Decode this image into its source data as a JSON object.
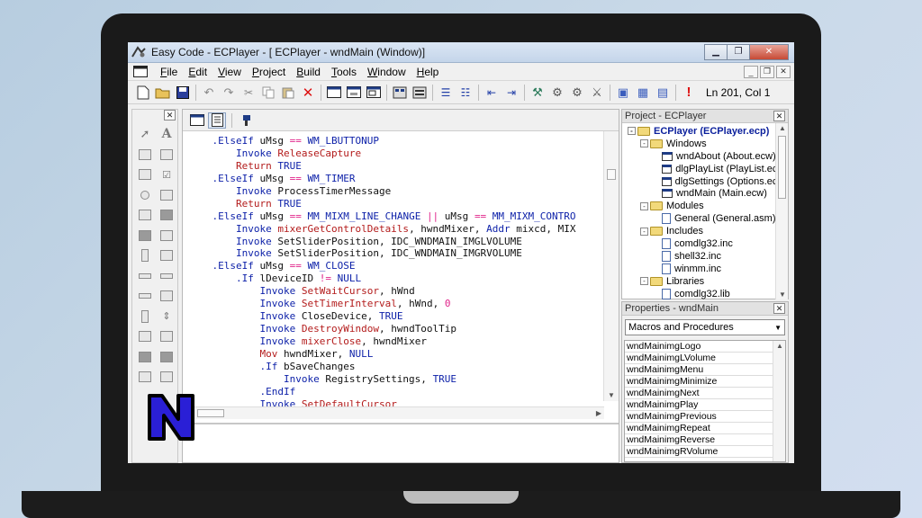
{
  "window": {
    "title": "Easy Code - ECPlayer - [ ECPlayer - wndMain (Window)]",
    "caption_buttons": [
      "minimize-icon",
      "maximize-icon",
      "close-icon"
    ]
  },
  "menu": {
    "items": [
      {
        "label": "File",
        "accel": "F"
      },
      {
        "label": "Edit",
        "accel": "E"
      },
      {
        "label": "View",
        "accel": "V"
      },
      {
        "label": "Project",
        "accel": "P"
      },
      {
        "label": "Build",
        "accel": "B"
      },
      {
        "label": "Tools",
        "accel": "T"
      },
      {
        "label": "Window",
        "accel": "W"
      },
      {
        "label": "Help",
        "accel": "H"
      }
    ]
  },
  "toolbar": {
    "line_col": "Ln 201, Col 1"
  },
  "editor": {
    "lines": [
      [
        {
          "t": "    ",
          "c": "tx"
        },
        {
          "t": ".ElseIf",
          "c": "kw"
        },
        {
          "t": " uMsg ",
          "c": "tx"
        },
        {
          "t": "==",
          "c": "op"
        },
        {
          "t": " WM_LBUTTONUP",
          "c": "kw"
        }
      ],
      [
        {
          "t": "        ",
          "c": "tx"
        },
        {
          "t": "Invoke",
          "c": "kw"
        },
        {
          "t": " ReleaseCapture",
          "c": "fn"
        }
      ],
      [
        {
          "t": "        ",
          "c": "tx"
        },
        {
          "t": "Return",
          "c": "fn"
        },
        {
          "t": " TRUE",
          "c": "kw"
        }
      ],
      [
        {
          "t": "    ",
          "c": "tx"
        },
        {
          "t": ".ElseIf",
          "c": "kw"
        },
        {
          "t": " uMsg ",
          "c": "tx"
        },
        {
          "t": "==",
          "c": "op"
        },
        {
          "t": " WM_TIMER",
          "c": "kw"
        }
      ],
      [
        {
          "t": "        ",
          "c": "tx"
        },
        {
          "t": "Invoke",
          "c": "kw"
        },
        {
          "t": " ProcessTimerMessage",
          "c": "tx"
        }
      ],
      [
        {
          "t": "        ",
          "c": "tx"
        },
        {
          "t": "Return",
          "c": "fn"
        },
        {
          "t": " TRUE",
          "c": "kw"
        }
      ],
      [
        {
          "t": "    ",
          "c": "tx"
        },
        {
          "t": ".ElseIf",
          "c": "kw"
        },
        {
          "t": " uMsg ",
          "c": "tx"
        },
        {
          "t": "==",
          "c": "op"
        },
        {
          "t": " MM_MIXM_LINE_CHANGE ",
          "c": "kw"
        },
        {
          "t": "||",
          "c": "op"
        },
        {
          "t": " uMsg ",
          "c": "tx"
        },
        {
          "t": "==",
          "c": "op"
        },
        {
          "t": " MM_MIXM_CONTRO",
          "c": "kw"
        }
      ],
      [
        {
          "t": "        ",
          "c": "tx"
        },
        {
          "t": "Invoke",
          "c": "kw"
        },
        {
          "t": " mixerGetControlDetails",
          "c": "fn"
        },
        {
          "t": ", hwndMixer, ",
          "c": "tx"
        },
        {
          "t": "Addr",
          "c": "kw"
        },
        {
          "t": " mixcd, MIX",
          "c": "tx"
        }
      ],
      [
        {
          "t": "        ",
          "c": "tx"
        },
        {
          "t": "Invoke",
          "c": "kw"
        },
        {
          "t": " SetSliderPosition, IDC_WNDMAIN_IMGLVOLUME",
          "c": "tx"
        }
      ],
      [
        {
          "t": "        ",
          "c": "tx"
        },
        {
          "t": "Invoke",
          "c": "kw"
        },
        {
          "t": " SetSliderPosition, IDC_WNDMAIN_IMGRVOLUME",
          "c": "tx"
        }
      ],
      [
        {
          "t": "    ",
          "c": "tx"
        },
        {
          "t": ".ElseIf",
          "c": "kw"
        },
        {
          "t": " uMsg ",
          "c": "tx"
        },
        {
          "t": "==",
          "c": "op"
        },
        {
          "t": " WM_CLOSE",
          "c": "kw"
        }
      ],
      [
        {
          "t": "        ",
          "c": "tx"
        },
        {
          "t": ".If",
          "c": "kw"
        },
        {
          "t": " lDeviceID ",
          "c": "tx"
        },
        {
          "t": "!=",
          "c": "op"
        },
        {
          "t": " NULL",
          "c": "kw"
        }
      ],
      [
        {
          "t": "            ",
          "c": "tx"
        },
        {
          "t": "Invoke",
          "c": "kw"
        },
        {
          "t": " SetWaitCursor",
          "c": "fn"
        },
        {
          "t": ", hWnd",
          "c": "tx"
        }
      ],
      [
        {
          "t": "            ",
          "c": "tx"
        },
        {
          "t": "Invoke",
          "c": "kw"
        },
        {
          "t": " SetTimerInterval",
          "c": "fn"
        },
        {
          "t": ", hWnd, ",
          "c": "tx"
        },
        {
          "t": "0",
          "c": "num"
        }
      ],
      [
        {
          "t": "            ",
          "c": "tx"
        },
        {
          "t": "Invoke",
          "c": "kw"
        },
        {
          "t": " CloseDevice, ",
          "c": "tx"
        },
        {
          "t": "TRUE",
          "c": "kw"
        }
      ],
      [
        {
          "t": "            ",
          "c": "tx"
        },
        {
          "t": "Invoke",
          "c": "kw"
        },
        {
          "t": " DestroyWindow",
          "c": "fn"
        },
        {
          "t": ", hwndToolTip",
          "c": "tx"
        }
      ],
      [
        {
          "t": "            ",
          "c": "tx"
        },
        {
          "t": "Invoke",
          "c": "kw"
        },
        {
          "t": " mixerClose",
          "c": "fn"
        },
        {
          "t": ", hwndMixer",
          "c": "tx"
        }
      ],
      [
        {
          "t": "            ",
          "c": "tx"
        },
        {
          "t": "Mov",
          "c": "fn"
        },
        {
          "t": " hwndMixer, ",
          "c": "tx"
        },
        {
          "t": "NULL",
          "c": "kw"
        }
      ],
      [
        {
          "t": "            ",
          "c": "tx"
        },
        {
          "t": ".If",
          "c": "kw"
        },
        {
          "t": " bSaveChanges",
          "c": "tx"
        }
      ],
      [
        {
          "t": "                ",
          "c": "tx"
        },
        {
          "t": "Invoke",
          "c": "kw"
        },
        {
          "t": " RegistrySettings, ",
          "c": "tx"
        },
        {
          "t": "TRUE",
          "c": "kw"
        }
      ],
      [
        {
          "t": "            ",
          "c": "tx"
        },
        {
          "t": ".EndIf",
          "c": "kw"
        }
      ],
      [
        {
          "t": "            ",
          "c": "tx"
        },
        {
          "t": "Invoke",
          "c": "kw"
        },
        {
          "t": " SetDefaultCursor",
          "c": "fn"
        }
      ]
    ]
  },
  "project": {
    "title": "Project - ECPlayer",
    "tree": [
      {
        "label": "ECPlayer (ECPlayer.ecp)",
        "kind": "root",
        "expanded": "-"
      },
      {
        "label": "Windows",
        "kind": "folder",
        "expanded": "-"
      },
      {
        "label": "wndAbout (About.ecw)",
        "kind": "window"
      },
      {
        "label": "dlgPlayList (PlayList.ecw)",
        "kind": "window"
      },
      {
        "label": "dlgSettings (Options.ecw)",
        "kind": "window"
      },
      {
        "label": "wndMain (Main.ecw)",
        "kind": "window"
      },
      {
        "label": "Modules",
        "kind": "folder",
        "expanded": "-"
      },
      {
        "label": "General (General.asm)",
        "kind": "file"
      },
      {
        "label": "Includes",
        "kind": "folder",
        "expanded": "-"
      },
      {
        "label": "comdlg32.inc",
        "kind": "file"
      },
      {
        "label": "shell32.inc",
        "kind": "file"
      },
      {
        "label": "winmm.inc",
        "kind": "file"
      },
      {
        "label": "Libraries",
        "kind": "folder",
        "expanded": "-"
      },
      {
        "label": "comdlg32.lib",
        "kind": "file"
      }
    ]
  },
  "properties": {
    "title": "Properties - wndMain",
    "dropdown_value": "Macros and Procedures",
    "items": [
      "wndMainimgLogo",
      "wndMainimgLVolume",
      "wndMainimgMenu",
      "wndMainimgMinimize",
      "wndMainimgNext",
      "wndMainimgPlay",
      "wndMainimgPrevious",
      "wndMainimgRepeat",
      "wndMainimgReverse",
      "wndMainimgRVolume"
    ]
  },
  "colors": {
    "keyword": "#0b1fa8",
    "function": "#b31b1b",
    "operator": "#e0248a",
    "logo_fill": "#2a1fd6",
    "logo_stroke": "#000000"
  },
  "overlay": {
    "logo_icon": "n-letter-logo"
  }
}
